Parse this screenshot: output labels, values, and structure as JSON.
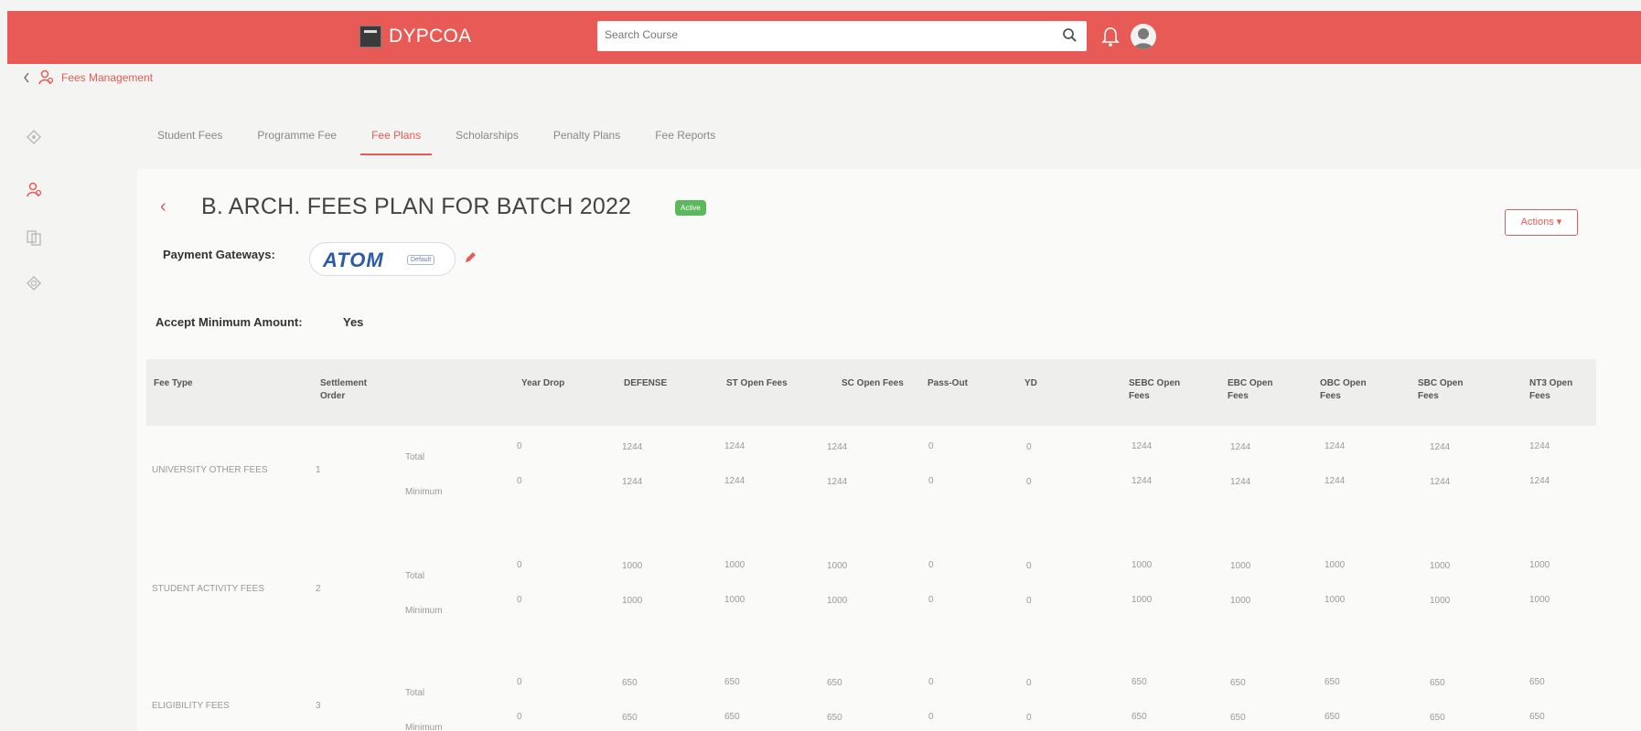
{
  "app": {
    "brand": "DYPCOA"
  },
  "search": {
    "placeholder": "Search Course"
  },
  "breadcrumb": {
    "label": "Fees Management"
  },
  "tabs": [
    {
      "label": "Student Fees",
      "active": false
    },
    {
      "label": "Programme Fee",
      "active": false
    },
    {
      "label": "Fee Plans",
      "active": true
    },
    {
      "label": "Scholarships",
      "active": false
    },
    {
      "label": "Penalty Plans",
      "active": false
    },
    {
      "label": "Fee Reports",
      "active": false
    }
  ],
  "plan": {
    "title": "B. ARCH. FEES PLAN FOR BATCH 2022",
    "status": "Active",
    "actions_label": "Actions ▾",
    "payment_gateways_label": "Payment Gateways:",
    "gateway_name": "ATOM",
    "gateway_default": "Default",
    "accept_min_label": "Accept Minimum Amount:",
    "accept_min_value": "Yes"
  },
  "table": {
    "headers": [
      "Fee Type",
      "Settlement Order",
      "",
      "Year Drop",
      "DEFENSE",
      "ST Open Fees",
      "SC Open Fees",
      "Pass-Out",
      "YD",
      "SEBC Open Fees",
      "EBC Open Fees",
      "OBC Open Fees",
      "SBC Open Fees",
      "NT3 Open Fees"
    ],
    "rows": [
      {
        "fee_type": "UNIVERSITY OTHER FEES",
        "order": "1",
        "lines": [
          {
            "label": "Total",
            "values": [
              "0",
              "1244",
              "1244",
              "1244",
              "0",
              "0",
              "1244",
              "1244",
              "1244",
              "1244",
              "1244"
            ]
          },
          {
            "label": "Minimum",
            "values": [
              "0",
              "1244",
              "1244",
              "1244",
              "0",
              "0",
              "1244",
              "1244",
              "1244",
              "1244",
              "1244"
            ]
          }
        ]
      },
      {
        "fee_type": "STUDENT ACTIVITY FEES",
        "order": "2",
        "lines": [
          {
            "label": "Total",
            "values": [
              "0",
              "1000",
              "1000",
              "1000",
              "0",
              "0",
              "1000",
              "1000",
              "1000",
              "1000",
              "1000"
            ]
          },
          {
            "label": "Minimum",
            "values": [
              "0",
              "1000",
              "1000",
              "1000",
              "0",
              "0",
              "1000",
              "1000",
              "1000",
              "1000",
              "1000"
            ]
          }
        ]
      },
      {
        "fee_type": "ELIGIBILITY FEES",
        "order": "3",
        "lines": [
          {
            "label": "Total",
            "values": [
              "0",
              "650",
              "650",
              "650",
              "0",
              "0",
              "650",
              "650",
              "650",
              "650",
              "650"
            ]
          },
          {
            "label": "Minimum",
            "values": [
              "0",
              "650",
              "650",
              "650",
              "0",
              "0",
              "650",
              "650",
              "650",
              "650",
              "650"
            ]
          }
        ]
      }
    ]
  }
}
